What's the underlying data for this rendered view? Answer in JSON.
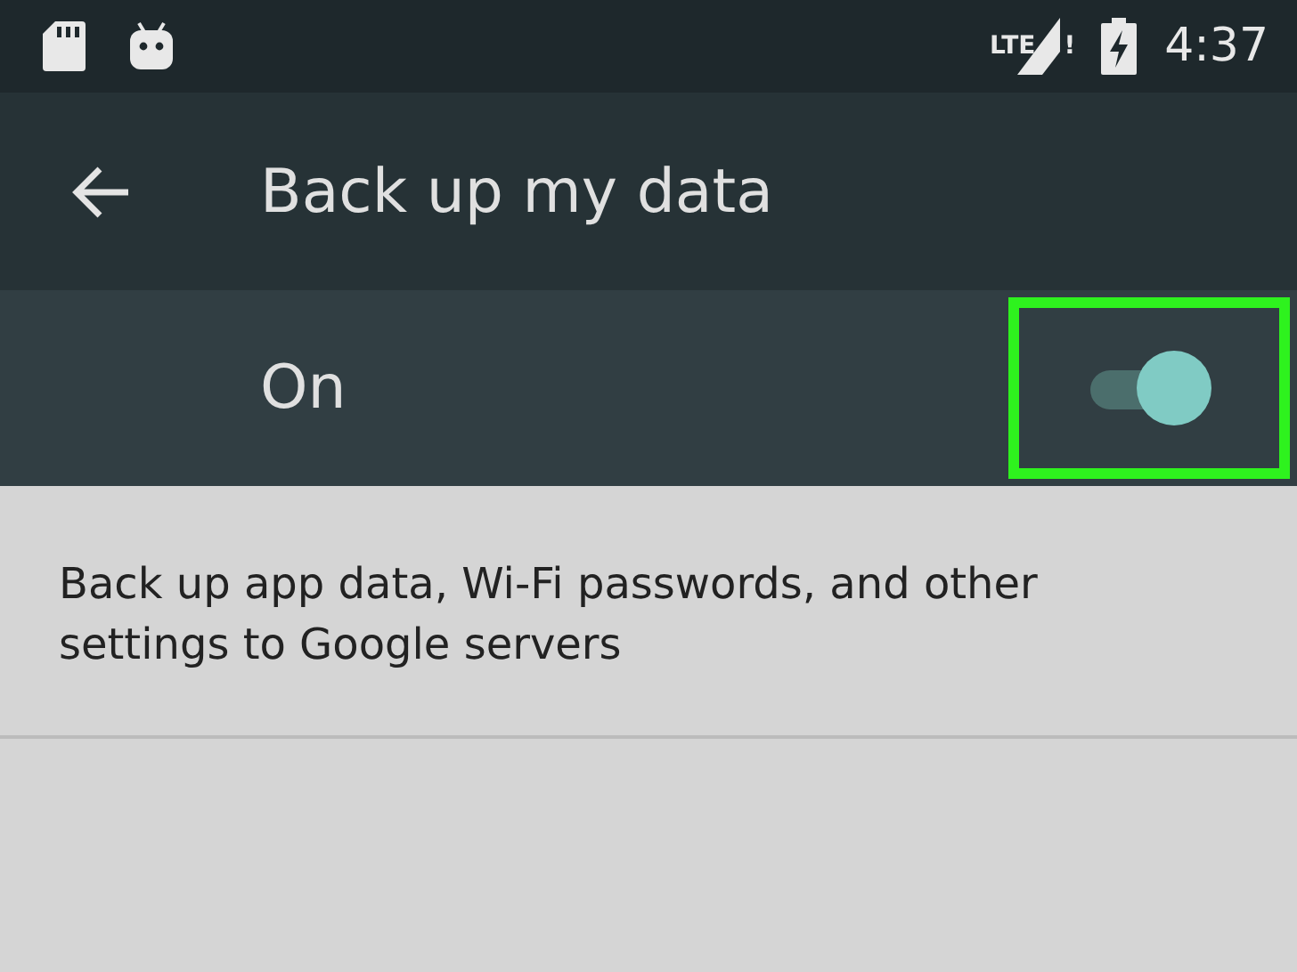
{
  "status_bar": {
    "network": "LTE",
    "signal_alert": "!",
    "time": "4:37"
  },
  "toolbar": {
    "title": "Back up my data"
  },
  "switch_row": {
    "label": "On",
    "on": true
  },
  "description": "Back up app data, Wi-Fi passwords, and other settings to Google servers"
}
